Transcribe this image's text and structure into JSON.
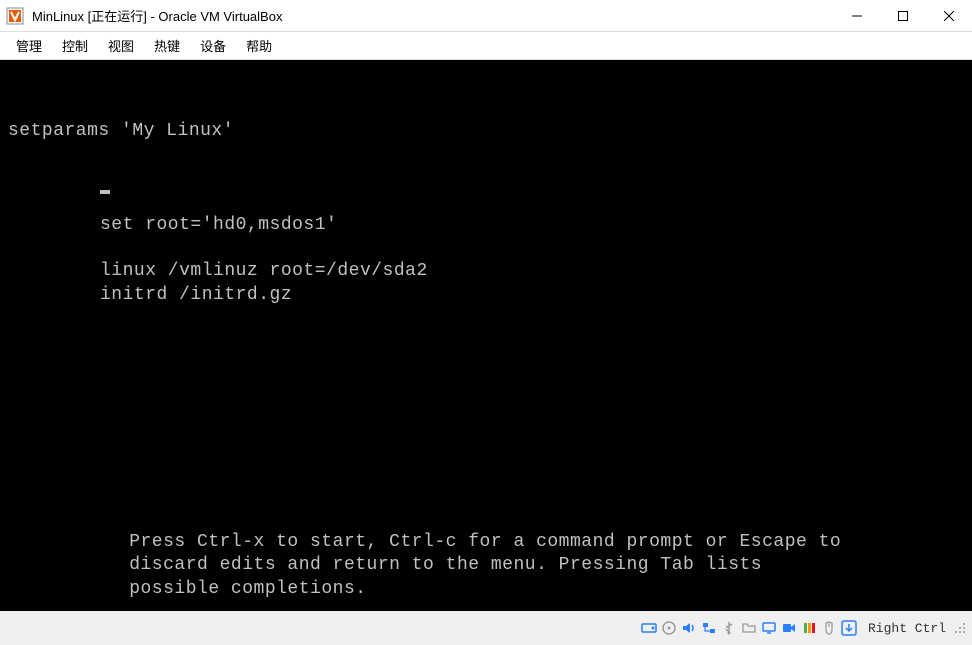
{
  "titlebar": {
    "title": "MinLinux [正在运行] - Oracle VM VirtualBox"
  },
  "menubar": {
    "items": [
      "管理",
      "控制",
      "视图",
      "热键",
      "设备",
      "帮助"
    ]
  },
  "grub": {
    "line_setparams": "setparams 'My Linux'",
    "line_root": "set root='hd0,msdos1'",
    "line_linux": "linux /vmlinuz root=/dev/sda2",
    "line_initrd": "initrd /initrd.gz",
    "help1": "    Press Ctrl-x to start, Ctrl-c for a command prompt or Escape to",
    "help2": "    discard edits and return to the menu. Pressing Tab lists",
    "help3": "    possible completions."
  },
  "statusbar": {
    "hostkey": "Right Ctrl",
    "icons": [
      "hard-disk-icon",
      "optical-disk-icon",
      "audio-icon",
      "network-icon",
      "usb-icon",
      "shared-folder-icon",
      "display-icon",
      "recording-icon",
      "cpu-icon",
      "mouse-icon",
      "keyboard-icon"
    ]
  },
  "colors": {
    "terminal_fg": "#c0c0c0",
    "terminal_bg": "#000000",
    "icon_blue": "#2a7fff",
    "icon_gray": "#9a9a9a",
    "icon_green": "#4caf50",
    "icon_orange": "#ff9800"
  }
}
